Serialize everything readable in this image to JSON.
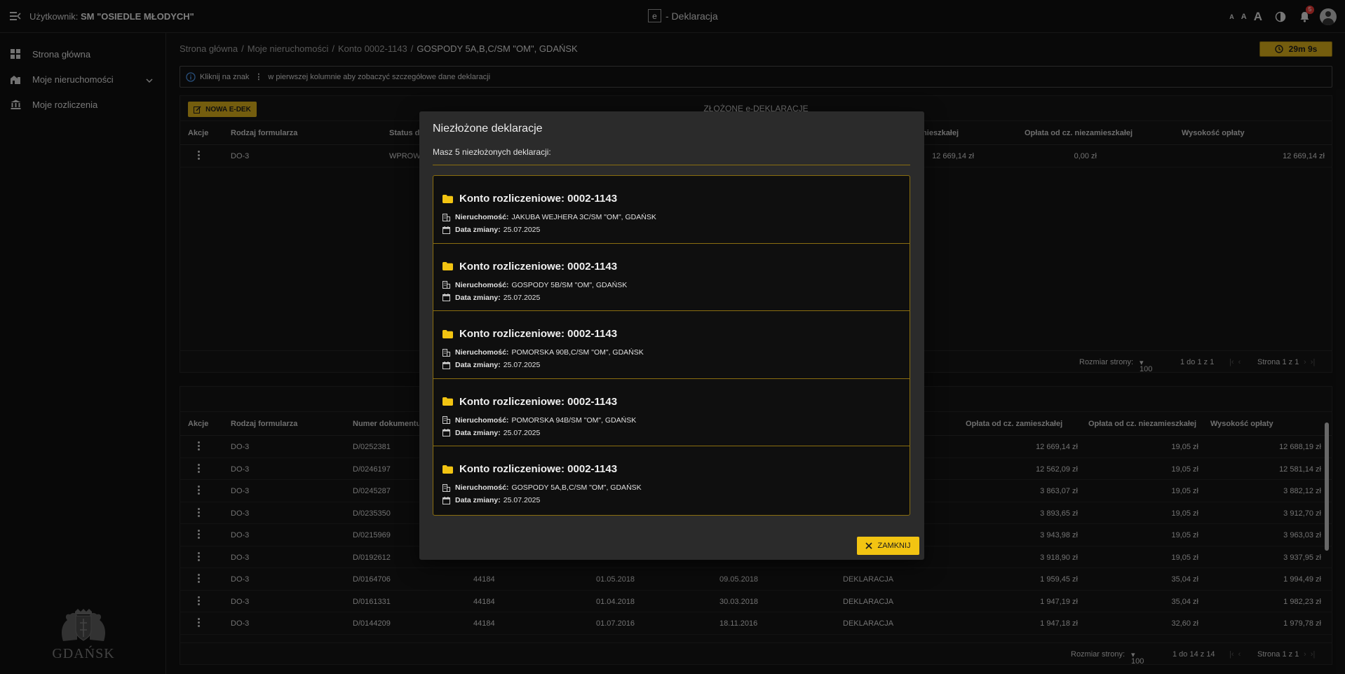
{
  "topbar": {
    "user_label": "Użytkownik:",
    "user_name": "SM \"OSIEDLE MŁODYCH\"",
    "logo_letter": "e",
    "app_title": "- Deklaracja",
    "font_small": "A",
    "font_medium": "A",
    "font_large": "A",
    "notifications_count": "5"
  },
  "sidebar": {
    "items": [
      {
        "label": "Strona główna",
        "icon": "dashboard-icon"
      },
      {
        "label": "Moje nieruchomości",
        "icon": "properties-icon"
      },
      {
        "label": "Moje rozliczenia",
        "icon": "bank-icon"
      }
    ],
    "logo_text": "GDAŃSK"
  },
  "breadcrumb": {
    "items": [
      "Strona główna",
      "Moje nieruchomości",
      "Konto 0002-1143",
      "GOSPODY 5A,B,C/SM \"OM\", GDAŃSK"
    ],
    "separator": "/"
  },
  "timer": "29m 9s",
  "info": {
    "before": "Kliknij na znak",
    "after": "w pierwszej kolumnie aby zobaczyć szczegółowe dane deklaracji"
  },
  "table1": {
    "new_button": "NOWA E-DEK",
    "title": "ZŁOŻONE e-DEKLARACJE",
    "headers": [
      "Akcje",
      "Rodzaj formularza",
      "Status do",
      "mieszkałej",
      "Opłata od cz. niezamieszkałej",
      "Wysokość opłaty"
    ],
    "row": {
      "form": "DO-3",
      "status": "WPROWA",
      "res": "12 669,14 zł",
      "nonres": "0,00 zł",
      "total": "12 669,14 zł"
    },
    "pager": {
      "size_label": "Rozmiar strony:",
      "size": "100",
      "range": "1 do 1 z 1",
      "page": "Strona 1 z 1"
    }
  },
  "table2": {
    "headers": [
      "Akcje",
      "Rodzaj formularza",
      "Numer dokumentu",
      "Opłata od cz. zamieszkałej",
      "Opłata od cz. niezamieszkałej",
      "Wysokość opłaty"
    ],
    "rows": [
      {
        "form": "DO-3",
        "doc": "D/0252381",
        "num": "",
        "from": "",
        "date": "",
        "kind": "",
        "res": "12 669,14 zł",
        "nonres": "19,05 zł",
        "total": "12 688,19 zł"
      },
      {
        "form": "DO-3",
        "doc": "D/0246197",
        "num": "",
        "from": "",
        "date": "",
        "kind": "",
        "res": "12 562,09 zł",
        "nonres": "19,05 zł",
        "total": "12 581,14 zł"
      },
      {
        "form": "DO-3",
        "doc": "D/0245287",
        "num": "",
        "from": "",
        "date": "",
        "kind": "",
        "res": "3 863,07 zł",
        "nonres": "19,05 zł",
        "total": "3 882,12 zł"
      },
      {
        "form": "DO-3",
        "doc": "D/0235350",
        "num": "",
        "from": "",
        "date": "",
        "kind": "",
        "res": "3 893,65 zł",
        "nonres": "19,05 zł",
        "total": "3 912,70 zł"
      },
      {
        "form": "DO-3",
        "doc": "D/0215969",
        "num": "",
        "from": "",
        "date": "",
        "kind": "",
        "res": "3 943,98 zł",
        "nonres": "19,05 zł",
        "total": "3 963,03 zł"
      },
      {
        "form": "DO-3",
        "doc": "D/0192612",
        "num": "",
        "from": "",
        "date": "",
        "kind": "",
        "res": "3 918,90 zł",
        "nonres": "19,05 zł",
        "total": "3 937,95 zł"
      },
      {
        "form": "DO-3",
        "doc": "D/0164706",
        "num": "44184",
        "from": "01.05.2018",
        "date": "09.05.2018",
        "kind": "DEKLARACJA",
        "res": "1 959,45 zł",
        "nonres": "35,04 zł",
        "total": "1 994,49 zł"
      },
      {
        "form": "DO-3",
        "doc": "D/0161331",
        "num": "44184",
        "from": "01.04.2018",
        "date": "30.03.2018",
        "kind": "DEKLARACJA",
        "res": "1 947,19 zł",
        "nonres": "35,04 zł",
        "total": "1 982,23 zł"
      },
      {
        "form": "DO-3",
        "doc": "D/0144209",
        "num": "44184",
        "from": "01.07.2016",
        "date": "18.11.2016",
        "kind": "DEKLARACJA",
        "res": "1 947,18 zł",
        "nonres": "32,60 zł",
        "total": "1 979,78 zł"
      }
    ],
    "pager": {
      "size_label": "Rozmiar strony:",
      "size": "100",
      "range": "1 do 14 z 14",
      "page": "Strona 1 z 1"
    }
  },
  "modal": {
    "title": "Niezłożone deklaracje",
    "subtitle": "Masz 5 niezłożonych deklaracji:",
    "property_label": "Nieruchomość:",
    "date_label": "Data zmiany:",
    "cards": [
      {
        "title": "Konto rozliczeniowe: 0002-1143",
        "property": "JAKUBA WEJHERA 3C/SM \"OM\", GDAŃSK",
        "date": "25.07.2025"
      },
      {
        "title": "Konto rozliczeniowe: 0002-1143",
        "property": "GOSPODY 5B/SM \"OM\", GDAŃSK",
        "date": "25.07.2025"
      },
      {
        "title": "Konto rozliczeniowe: 0002-1143",
        "property": "POMORSKA 90B,C/SM \"OM\", GDAŃSK",
        "date": "25.07.2025"
      },
      {
        "title": "Konto rozliczeniowe: 0002-1143",
        "property": "POMORSKA 94B/SM \"OM\", GDAŃSK",
        "date": "25.07.2025"
      },
      {
        "title": "Konto rozliczeniowe: 0002-1143",
        "property": "GOSPODY 5A,B,C/SM \"OM\", GDAŃSK",
        "date": "25.07.2025"
      }
    ],
    "close_label": "ZAMKNIJ"
  },
  "colors": {
    "accent": "#d4a91a",
    "close_button": "#f2c412",
    "background": "#121212"
  }
}
